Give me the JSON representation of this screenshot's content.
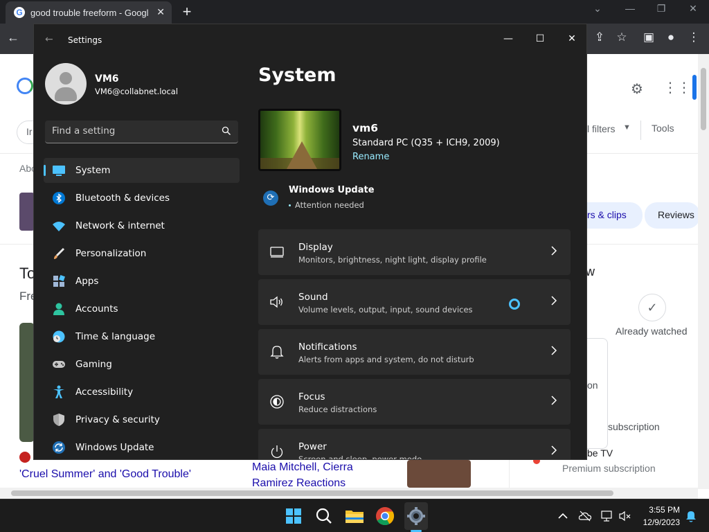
{
  "chrome": {
    "tab_title": "good trouble freeform - Google",
    "page": {
      "filters_label": "l filters",
      "tools_label": "Tools",
      "about_text": "Abo",
      "chip_clips": "rs & clips",
      "chip_reviews": "Reviews",
      "to_text": "To",
      "fre_text": "Fre",
      "already_watched": "Already watched",
      "w_text": "w",
      "on_text": "on",
      "subscription_text": "subscription",
      "be_tv": "be TV",
      "premium_subscription": "Premium subscription",
      "link_cruel_summer": "'Cruel Summer' and 'Good Trouble'",
      "link_maia_1": "Maia Mitchell, Cierra",
      "link_maia_2": "Ramirez Reactions",
      "partial_in": "Ir"
    }
  },
  "settings": {
    "window_title": "Settings",
    "profile": {
      "name": "VM6",
      "email": "VM6@collabnet.local"
    },
    "search": {
      "placeholder": "Find a setting"
    },
    "nav": [
      {
        "label": "System",
        "icon": "monitor-icon",
        "color": "#4cc2ff",
        "active": true
      },
      {
        "label": "Bluetooth & devices",
        "icon": "bluetooth-icon",
        "color": "#4cc2ff"
      },
      {
        "label": "Network & internet",
        "icon": "wifi-icon",
        "color": "#4cc2ff"
      },
      {
        "label": "Personalization",
        "icon": "brush-icon",
        "color": "#e8a060"
      },
      {
        "label": "Apps",
        "icon": "apps-icon",
        "color": "#a0b8d8"
      },
      {
        "label": "Accounts",
        "icon": "person-icon",
        "color": "#2ec4a0"
      },
      {
        "label": "Time & language",
        "icon": "globe-clock-icon",
        "color": "#4cc2ff"
      },
      {
        "label": "Gaming",
        "icon": "gamepad-icon",
        "color": "#c8c8c8"
      },
      {
        "label": "Accessibility",
        "icon": "accessibility-icon",
        "color": "#4cc2ff"
      },
      {
        "label": "Privacy & security",
        "icon": "shield-icon",
        "color": "#a8a8a8"
      },
      {
        "label": "Windows Update",
        "icon": "update-icon",
        "color": "#4cc2ff"
      }
    ],
    "page_title": "System",
    "device": {
      "name": "vm6",
      "model": "Standard PC (Q35 + ICH9, 2009)",
      "rename_label": "Rename"
    },
    "windows_update": {
      "title": "Windows Update",
      "status": "Attention needed"
    },
    "cards": [
      {
        "title": "Display",
        "subtitle": "Monitors, brightness, night light, display profile",
        "icon": "display-icon"
      },
      {
        "title": "Sound",
        "subtitle": "Volume levels, output, input, sound devices",
        "icon": "speaker-icon"
      },
      {
        "title": "Notifications",
        "subtitle": "Alerts from apps and system, do not disturb",
        "icon": "bell-icon"
      },
      {
        "title": "Focus",
        "subtitle": "Reduce distractions",
        "icon": "focus-icon"
      },
      {
        "title": "Power",
        "subtitle": "Screen and sleep, power mode",
        "icon": "power-icon"
      }
    ]
  },
  "taskbar": {
    "time": "3:55 PM",
    "date": "12/9/2023"
  },
  "colors": {
    "accent": "#4cc2ff",
    "link": "#99ebff",
    "settings_bg": "#202020",
    "card_bg": "#2b2b2b"
  }
}
